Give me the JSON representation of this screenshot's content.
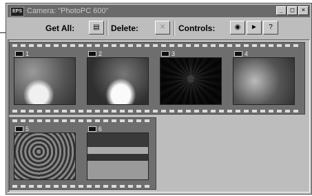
{
  "window": {
    "title": "Camera: \"PhotoPC 600\"",
    "controls": [
      "_",
      "□",
      "×"
    ]
  },
  "toolbar": {
    "get_all_label": "Get All:",
    "delete_label": "Delete:",
    "controls_label": "Controls:",
    "get_all_icon": "camera-download-icon",
    "delete_icon": "trash-icon",
    "controls_icons": [
      "camera-icon",
      "arrow-icon",
      "help-icon"
    ]
  },
  "photos": [
    {
      "number": "1"
    },
    {
      "number": "2"
    },
    {
      "number": "3"
    },
    {
      "number": "4"
    },
    {
      "number": "5"
    },
    {
      "number": "6"
    }
  ]
}
